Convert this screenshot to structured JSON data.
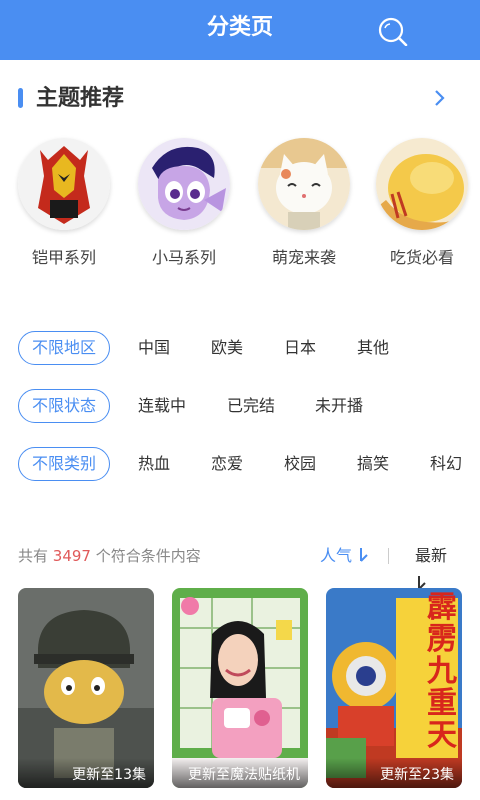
{
  "header": {
    "title": "分类页",
    "search_icon": "search-icon"
  },
  "themes_section": {
    "title": "主题推荐",
    "more_icon": "chevron-right-icon",
    "items": [
      {
        "label": "铠甲系列"
      },
      {
        "label": "小马系列"
      },
      {
        "label": "萌宠来袭"
      },
      {
        "label": "吃货必看"
      }
    ]
  },
  "filters": {
    "region": {
      "selected": "不限地区",
      "options": [
        "中国",
        "欧美",
        "日本",
        "其他"
      ]
    },
    "status": {
      "selected": "不限状态",
      "options": [
        "连载中",
        "已完结",
        "未开播"
      ]
    },
    "category": {
      "selected": "不限类别",
      "options": [
        "热血",
        "恋爱",
        "校园",
        "搞笑",
        "科幻"
      ]
    }
  },
  "results": {
    "prefix": "共有",
    "count": "3497",
    "suffix": "个符合条件内容",
    "sort_hot": "人气",
    "sort_new": "最新"
  },
  "cards": [
    {
      "caption": "更新至13集"
    },
    {
      "caption": "更新至魔法贴纸机"
    },
    {
      "caption": "更新至23集",
      "title_art": "霹雳九重天"
    }
  ],
  "colors": {
    "accent": "#4a8ef2",
    "count": "#e05a5a"
  }
}
